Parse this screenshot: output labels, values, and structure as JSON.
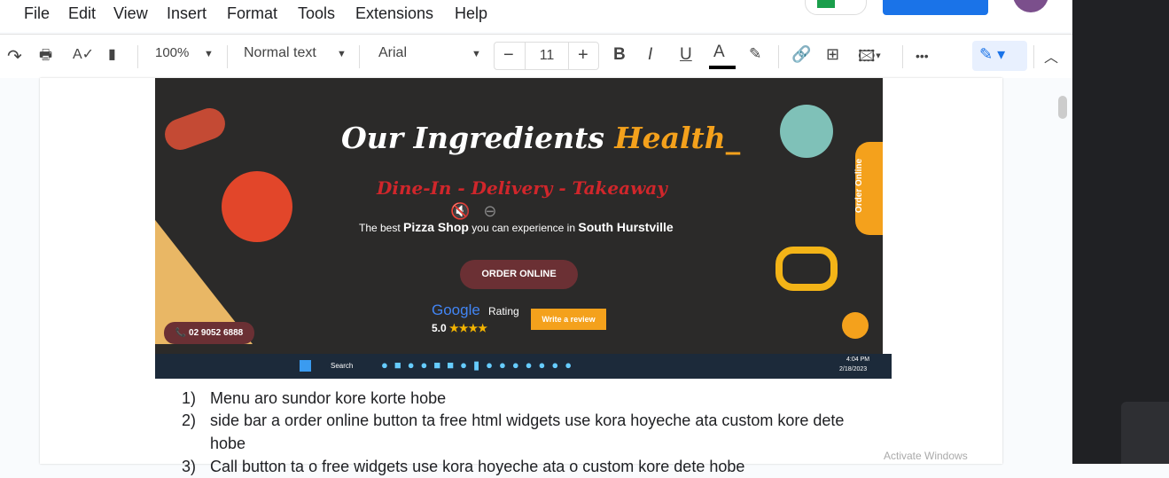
{
  "menu": [
    "File",
    "Edit",
    "View",
    "Insert",
    "Format",
    "Tools",
    "Extensions",
    "Help"
  ],
  "toolbar": {
    "zoom": "100%",
    "style": "Normal text",
    "font": "Arial",
    "font_size": "11",
    "more": "•••"
  },
  "image": {
    "title_white": "Our Ingredients ",
    "title_orange": "Health_",
    "subtitle": "Dine-In - Delivery - Takeaway",
    "tagline_pre": "The best ",
    "tagline_b1": "Pizza Shop",
    "tagline_mid": " you can experience in ",
    "tagline_b2": "South Hurstville",
    "order_button": "ORDER ONLINE",
    "google": "Google",
    "rating_label": "Rating",
    "rating": "5.0",
    "stars": "★★★★",
    "review_button": "Write a review",
    "phone": "📞 02 9052 6888",
    "side_tab": "Order Online",
    "taskbar_search": "Search",
    "time": "4:04 PM",
    "date": "2/18/2023"
  },
  "list": [
    {
      "n": "1)",
      "text": "Menu aro sundor kore korte hobe"
    },
    {
      "n": "2)",
      "text": "side bar a order online button ta free html widgets use kora hoyeche ata custom kore dete hobe"
    },
    {
      "n": "3)",
      "text": "Call button ta o free widgets use kora hoyeche ata o custom kore dete hobe"
    }
  ],
  "watermark": "Activate Windows"
}
